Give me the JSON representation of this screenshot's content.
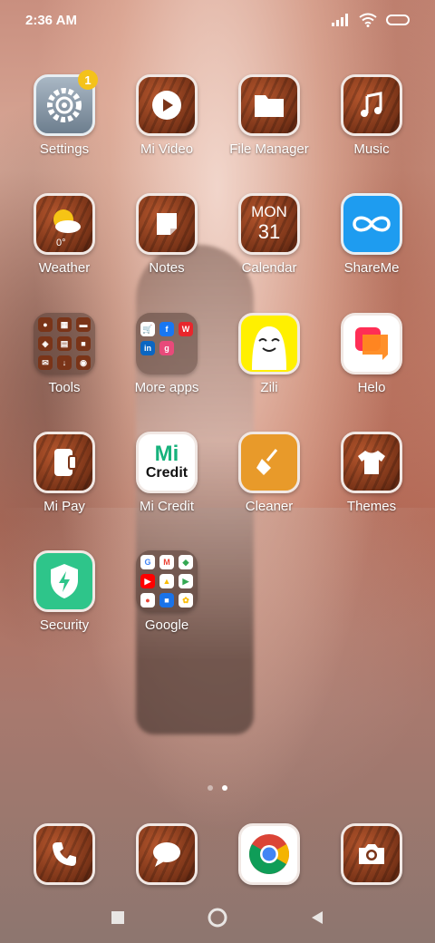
{
  "status_bar": {
    "time": "2:36 AM",
    "icons": [
      "signal-icon",
      "wifi-icon",
      "battery-icon"
    ]
  },
  "apps": {
    "settings": {
      "label": "Settings",
      "badge": "1"
    },
    "mi_video": {
      "label": "Mi Video"
    },
    "file_manager": {
      "label": "File Manager"
    },
    "music": {
      "label": "Music"
    },
    "weather": {
      "label": "Weather",
      "temp": "0°"
    },
    "notes": {
      "label": "Notes"
    },
    "calendar": {
      "label": "Calendar",
      "day": "MON",
      "date": "31"
    },
    "shareme": {
      "label": "ShareMe"
    },
    "tools": {
      "label": "Tools"
    },
    "more_apps": {
      "label": "More apps"
    },
    "zili": {
      "label": "Zili"
    },
    "helo": {
      "label": "Helo"
    },
    "mi_pay": {
      "label": "Mi Pay"
    },
    "mi_credit": {
      "label": "Mi Credit",
      "icon_text_top": "Mi",
      "icon_text_bottom": "Credit"
    },
    "cleaner": {
      "label": "Cleaner"
    },
    "themes": {
      "label": "Themes"
    },
    "security": {
      "label": "Security"
    },
    "google": {
      "label": "Google"
    }
  },
  "page_indicator": {
    "pages": 2,
    "active": 2
  },
  "dock": [
    "phone-icon",
    "messages-icon",
    "chrome-icon",
    "camera-icon"
  ],
  "nav": [
    "recents-button",
    "home-button",
    "back-button"
  ],
  "colors": {
    "accent_badge": "#f4c21b",
    "shareme": "#1e9cf0",
    "cleaner": "#e89a2a",
    "security": "#2ec58a"
  }
}
